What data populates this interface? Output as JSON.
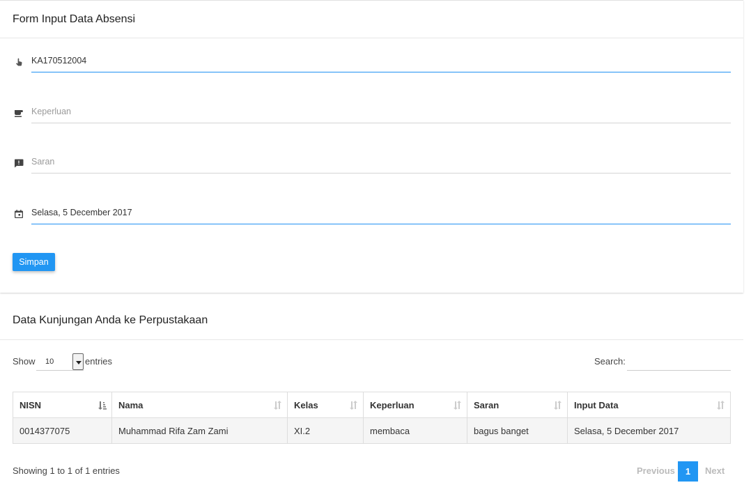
{
  "form": {
    "title": "Form Input Data Absensi",
    "nisn_value": "KA170512004",
    "keperluan_placeholder": "Keperluan",
    "saran_placeholder": "Saran",
    "date_value": "Selasa, 5 December 2017",
    "save_label": "Simpan",
    "icons": [
      "touch-hand-icon",
      "coffee-icon",
      "feedback-icon",
      "calendar-icon"
    ]
  },
  "visits": {
    "title": "Data Kunjungan Anda ke Perpustakaan",
    "show_label": "Show",
    "entries_value": "10",
    "entries_label": "entries",
    "search_label": "Search:",
    "columns": [
      "NISN",
      "Nama",
      "Kelas",
      "Keperluan",
      "Saran",
      "Input Data"
    ],
    "rows": [
      [
        "0014377075",
        "Muhammad Rifa Zam Zami",
        "XI.2",
        "membaca",
        "bagus banget",
        "Selasa, 5 December 2017"
      ]
    ],
    "info": "Showing 1 to 1 of 1 entries",
    "pagination": {
      "previous": "Previous",
      "current": "1",
      "next": "Next"
    }
  },
  "colors": {
    "accent": "#2196f3",
    "active_underline": "#1f91f3"
  }
}
